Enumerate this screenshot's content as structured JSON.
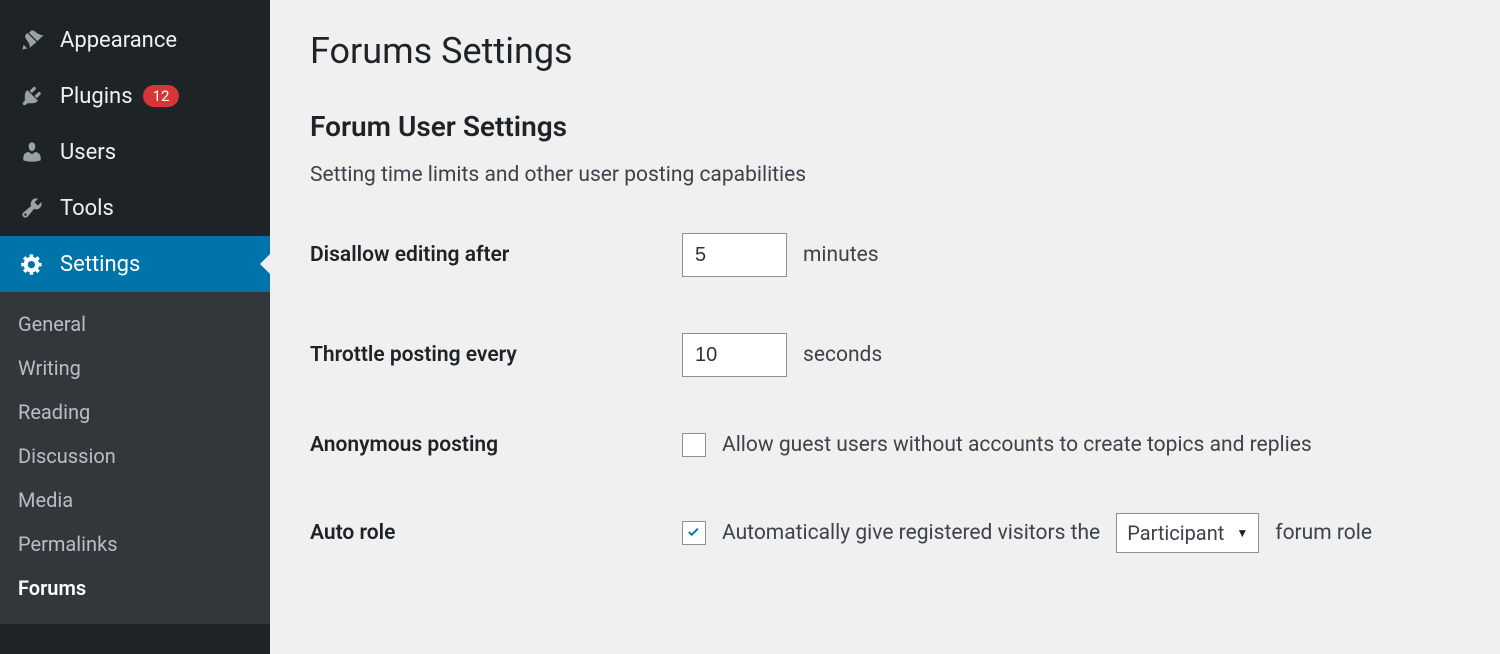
{
  "sidebar": {
    "items": [
      {
        "label": "Appearance",
        "icon": "appearance"
      },
      {
        "label": "Plugins",
        "icon": "plugins",
        "badge": "12"
      },
      {
        "label": "Users",
        "icon": "users"
      },
      {
        "label": "Tools",
        "icon": "tools"
      },
      {
        "label": "Settings",
        "icon": "settings",
        "active": true
      }
    ],
    "submenu": [
      {
        "label": "General"
      },
      {
        "label": "Writing"
      },
      {
        "label": "Reading"
      },
      {
        "label": "Discussion"
      },
      {
        "label": "Media"
      },
      {
        "label": "Permalinks"
      },
      {
        "label": "Forums",
        "current": true
      }
    ]
  },
  "main": {
    "title": "Forums Settings",
    "section_heading": "Forum User Settings",
    "section_desc": "Setting time limits and other user posting capabilities",
    "rows": {
      "disallow_edit": {
        "label": "Disallow editing after",
        "value": "5",
        "suffix": "minutes"
      },
      "throttle": {
        "label": "Throttle posting every",
        "value": "10",
        "suffix": "seconds"
      },
      "anonymous": {
        "label": "Anonymous posting",
        "checked": false,
        "text": "Allow guest users without accounts to create topics and replies"
      },
      "auto_role": {
        "label": "Auto role",
        "checked": true,
        "text_before": "Automatically give registered visitors the",
        "select": "Participant",
        "text_after": "forum role"
      }
    }
  }
}
